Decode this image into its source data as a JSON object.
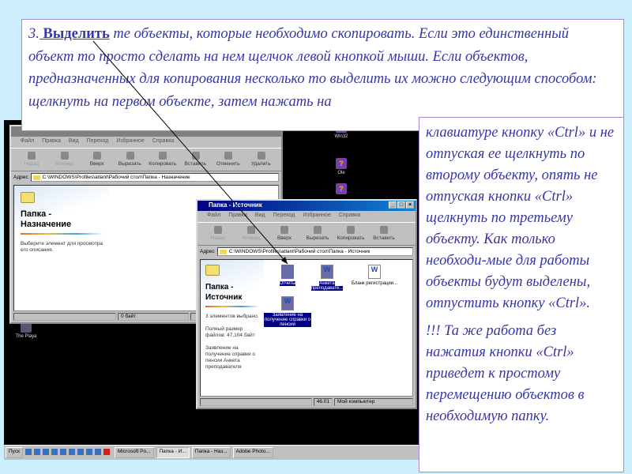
{
  "slide": {
    "top_number": "3.",
    "top_bold": " Выделить",
    "top_text": " те объекты, которые необходимо скопировать. Если это единственный объект то просто сделать на нем щелчок левой кнопкой мыши. Если объектов, предназначенных для копирования несколько то выделить их можно следующим способом: щелкнуть на первом объекте, затем нажать на",
    "right_p1": "клавиатуре  кнопку «Ctrl» и не отпуская ее щелкнуть по второму объекту, опять не отпуская кнопки «Ctrl» щелкнуть по третьему объекту. Как только необходи-мые для работы объекты будут выделены, отпустить кнопку «Ctrl».",
    "right_p2": "!!! Та же работа без нажатия кнопки «Ctrl» приведет к простому перемещению объектов в необходимую папку."
  },
  "menu": [
    "Файл",
    "Правка",
    "Вид",
    "Переход",
    "Избранное",
    "Справка"
  ],
  "toolbar1": [
    "Назад",
    "Вперед",
    "Вверх",
    "Вырезать",
    "Копировать",
    "Вставить",
    "Отменить",
    "Удалить"
  ],
  "toolbar2": [
    "Назад",
    "Вперед",
    "Вверх",
    "Вырезать",
    "Копировать",
    "Вставить"
  ],
  "win_dest": {
    "address_label": "Адрес",
    "address": "C:\\WINDOWS\\Profiles\\atlant\\Рабочий стол\\Папка - Назначение",
    "panel_title": "Папка - Назначение",
    "panel_desc": "Выберите элемент для просмотра его описания.",
    "status": "0 байт"
  },
  "win_src": {
    "title": "Папка - Источник",
    "address_label": "Адрес",
    "address": "C:\\WINDOWS\\Profiles\\atlant\\Рабочий стол\\Папка - Источник",
    "panel_title": "Папка - Источник",
    "panel_desc1": "3 элементов выбрано.",
    "panel_desc2": "Полный размер файлов: 47,104 байт",
    "panel_desc3": "Заявление на получение справки о пенсии Анкета преподавателя",
    "files": [
      {
        "name": "Отчеты",
        "type": "folder",
        "selected": true
      },
      {
        "name": "Анкета преподавате...",
        "type": "word",
        "selected": true
      },
      {
        "name": "Бланк регистрации...",
        "type": "word",
        "selected": false
      },
      {
        "name": "Заявление на получение справки о пенсии",
        "type": "word",
        "selected": true
      }
    ],
    "status_size": "46.01",
    "status_zone": "Мой компьютер"
  },
  "desktop_icons": [
    "Win32",
    "Ole",
    "",
    "The Playa"
  ],
  "taskbar": {
    "start": "Пуск",
    "tasks": [
      {
        "label": "Microsoft Po...",
        "active": false
      },
      {
        "label": "Папка - И...",
        "active": true
      },
      {
        "label": "Папка - Наз...",
        "active": false
      },
      {
        "label": "Adobe Photo...",
        "active": false
      }
    ]
  }
}
